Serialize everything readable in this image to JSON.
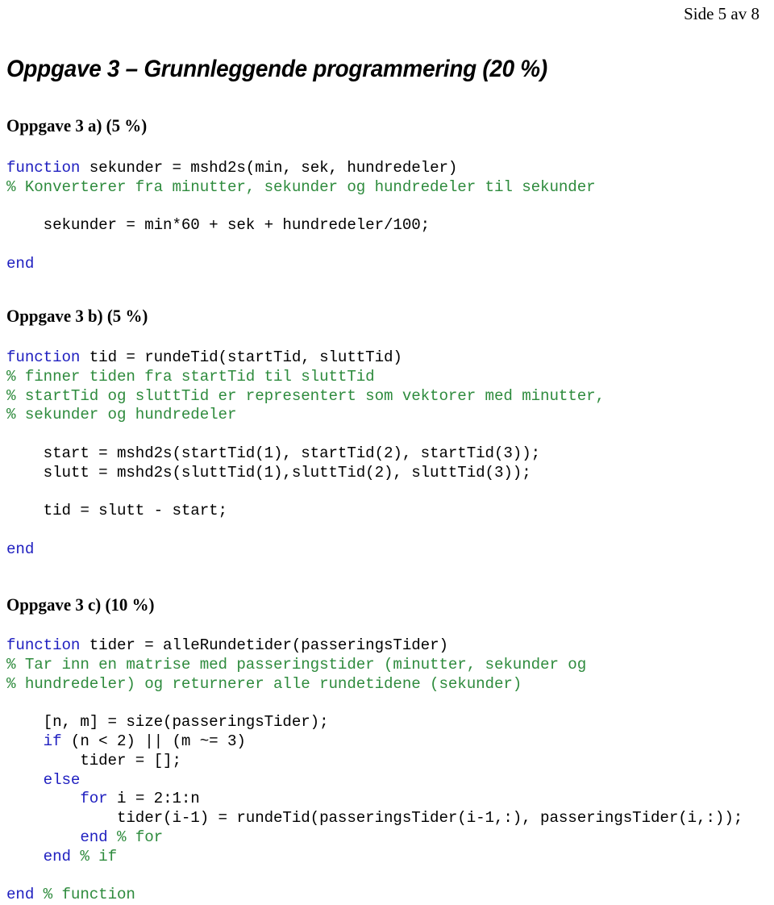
{
  "header": {
    "page_indicator": "Side 5 av 8"
  },
  "title": "Oppgave 3 – Grunnleggende programmering (20 %)",
  "colors": {
    "keyword": "#2020c0",
    "comment": "#2e8b3d",
    "code": "#000000",
    "text": "#000000",
    "background": "#ffffff"
  },
  "sections": [
    {
      "heading": "Oppgave 3 a) (5 %)",
      "code_lines": [
        [
          {
            "t": "function",
            "c": "kw"
          },
          {
            "t": " sekunder = mshd2s(min, sek, hundredeler)",
            "c": "pl"
          }
        ],
        [
          {
            "t": "% Konverterer fra minutter, sekunder og hundredeler til sekunder",
            "c": "cm"
          }
        ],
        [
          {
            "t": "",
            "c": "pl"
          }
        ],
        [
          {
            "t": "    sekunder = min*60 + sek + hundredeler/100;",
            "c": "pl"
          }
        ],
        [
          {
            "t": "",
            "c": "pl"
          }
        ],
        [
          {
            "t": "end",
            "c": "kw"
          }
        ]
      ]
    },
    {
      "heading": "Oppgave 3 b) (5 %)",
      "code_lines": [
        [
          {
            "t": "function",
            "c": "kw"
          },
          {
            "t": " tid = rundeTid(startTid, sluttTid)",
            "c": "pl"
          }
        ],
        [
          {
            "t": "% finner tiden fra startTid til sluttTid",
            "c": "cm"
          }
        ],
        [
          {
            "t": "% startTid og sluttTid er representert som vektorer med minutter,",
            "c": "cm"
          }
        ],
        [
          {
            "t": "% sekunder og hundredeler",
            "c": "cm"
          }
        ],
        [
          {
            "t": "",
            "c": "pl"
          }
        ],
        [
          {
            "t": "    start = mshd2s(startTid(1), startTid(2), startTid(3));",
            "c": "pl"
          }
        ],
        [
          {
            "t": "    slutt = mshd2s(sluttTid(1),sluttTid(2), sluttTid(3));",
            "c": "pl"
          }
        ],
        [
          {
            "t": "",
            "c": "pl"
          }
        ],
        [
          {
            "t": "    tid = slutt - start;",
            "c": "pl"
          }
        ],
        [
          {
            "t": "",
            "c": "pl"
          }
        ],
        [
          {
            "t": "end",
            "c": "kw"
          }
        ]
      ]
    },
    {
      "heading": "Oppgave 3 c) (10 %)",
      "code_lines": [
        [
          {
            "t": "function",
            "c": "kw"
          },
          {
            "t": " tider = alleRundetider(passeringsTider)",
            "c": "pl"
          }
        ],
        [
          {
            "t": "% Tar inn en matrise med passeringstider (minutter, sekunder og",
            "c": "cm"
          }
        ],
        [
          {
            "t": "% hundredeler) og returnerer alle rundetidene (sekunder)",
            "c": "cm"
          }
        ],
        [
          {
            "t": "",
            "c": "pl"
          }
        ],
        [
          {
            "t": "    [n, m] = size(passeringsTider);",
            "c": "pl"
          }
        ],
        [
          {
            "t": "    ",
            "c": "pl"
          },
          {
            "t": "if",
            "c": "kw"
          },
          {
            "t": " (n < 2) || (m ~= 3)",
            "c": "pl"
          }
        ],
        [
          {
            "t": "        tider = [];",
            "c": "pl"
          }
        ],
        [
          {
            "t": "    ",
            "c": "pl"
          },
          {
            "t": "else",
            "c": "kw"
          }
        ],
        [
          {
            "t": "        ",
            "c": "pl"
          },
          {
            "t": "for",
            "c": "kw"
          },
          {
            "t": " i = 2:1:n",
            "c": "pl"
          }
        ],
        [
          {
            "t": "            tider(i-1) = rundeTid(passeringsTider(i-1,:), passeringsTider(i,:));",
            "c": "pl"
          }
        ],
        [
          {
            "t": "        ",
            "c": "pl"
          },
          {
            "t": "end",
            "c": "kw"
          },
          {
            "t": " ",
            "c": "pl"
          },
          {
            "t": "% for",
            "c": "cm"
          }
        ],
        [
          {
            "t": "    ",
            "c": "pl"
          },
          {
            "t": "end",
            "c": "kw"
          },
          {
            "t": " ",
            "c": "pl"
          },
          {
            "t": "% if",
            "c": "cm"
          }
        ],
        [
          {
            "t": "",
            "c": "pl"
          }
        ],
        [
          {
            "t": "end",
            "c": "kw"
          },
          {
            "t": " ",
            "c": "pl"
          },
          {
            "t": "% function",
            "c": "cm"
          }
        ]
      ]
    }
  ]
}
